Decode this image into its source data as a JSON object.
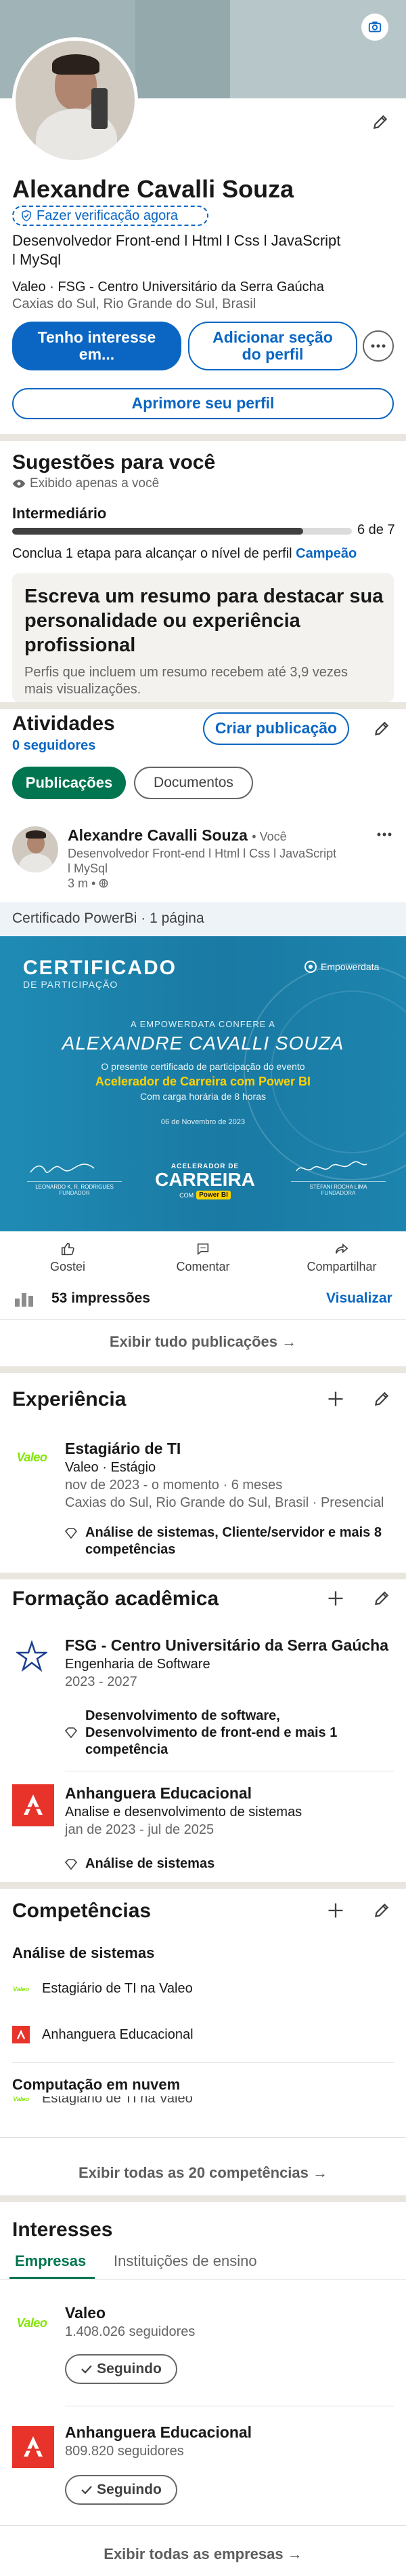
{
  "profile": {
    "name": "Alexandre Cavalli Souza",
    "verify_label": "Fazer verificação agora",
    "headline_line1": "Desenvolvedor Front-end l Html l Css l JavaScript",
    "headline_line2": "l MySql",
    "company_edu": "Valeo · FSG - Centro Universitário da Serra Gaúcha",
    "location": "Caxias do Sul, Rio Grande do Sul, Brasil",
    "interest_button": "Tenho interesse em...",
    "add_section_button": "Adicionar seção do perfil",
    "improve_button": "Aprimore seu perfil",
    "banner_color": "#a0b4b7",
    "avatar_bg": "#cfc9c0"
  },
  "suggestions": {
    "title": "Sugestões para você",
    "visibility": "Exibido apenas a você",
    "level": "Intermediário",
    "progress_label": "6 de 7",
    "progress_fraction": 0.857,
    "hint_prefix": "Conclua 1 etapa para alcançar o nível de perfil",
    "hint_link": "Campeão",
    "card_title_line1": "Escreva um resumo para destacar sua",
    "card_title_line2": "personalidade ou experiência",
    "card_title_line3": "profissional",
    "card_desc_line1": "Perfis que incluem um resumo recebem até 3,9 vezes",
    "card_desc_line2": "mais visualizações."
  },
  "activity": {
    "title": "Atividades",
    "followers": "0 seguidores",
    "create_post_button": "Criar publicação",
    "tabs": [
      "Publicações",
      "Documentos"
    ],
    "post": {
      "author": "Alexandre Cavalli Souza",
      "author_badge": "• Você",
      "headline_line1": "Desenvolvedor Front-end l Html l Css l JavaScript",
      "headline_line2": "l MySql",
      "time": "3 m •",
      "doc_title": "Certificado PowerBi · 1 página",
      "cert": {
        "title": "CERTIFICADO",
        "subtitle": "DE PARTICIPAÇÃO",
        "brand": "Empowerdata",
        "confers": "A EMPOWERDATA CONFERE A",
        "recipient": "ALEXANDRE CAVALLI SOUZA",
        "desc": "O presente certificado de participação do evento",
        "event": "Acelerador de Carreira com Power BI",
        "hours": "Com carga horária de 8 horas",
        "date": "06 de Novembro de 2023",
        "sig1_name": "LEONARDO K. R. RODRIGUES",
        "sig1_role": "FUNDADOR",
        "sig2_name": "STÉFANI ROCHA LIMA",
        "sig2_role": "FUNDADORA",
        "logo_top": "ACELERADOR DE",
        "logo_main": "CARREIRA",
        "logo_bottom": "COM",
        "logo_tag": "Power BI"
      },
      "actions": [
        "Gostei",
        "Comentar",
        "Compartilhar"
      ],
      "impressions": "53 impressões",
      "view_link": "Visualizar"
    },
    "show_all": "Exibir tudo publicações →"
  },
  "experience": {
    "title": "Experiência",
    "items": [
      {
        "logo": "Valeo",
        "role": "Estagiário de TI",
        "company": "Valeo · Estágio",
        "dates": "nov de 2023 - o momento · 6 meses",
        "location": "Caxias do Sul, Rio Grande do Sul, Brasil · Presencial",
        "skills_line1": "Análise de sistemas, Cliente/servidor e mais 8",
        "skills_line2": "competências"
      }
    ]
  },
  "education": {
    "title": "Formação acadêmica",
    "items": [
      {
        "school": "FSG - Centro Universitário da Serra Gaúcha",
        "degree": "Engenharia de Software",
        "dates": "2023 - 2027",
        "activities_line1": "Desenvolvimento de software,",
        "activities_line2": "Desenvolvimento de front-end e mais 1",
        "activities_line3": "competência"
      },
      {
        "school": "Anhanguera Educacional",
        "degree": "Analise e desenvolvimento de sistemas",
        "dates": "jan de 2023 - jul de 2025",
        "skills": "Análise de sistemas"
      }
    ]
  },
  "skills": {
    "title": "Competências",
    "skill1": "Análise de sistemas",
    "skill1_items": [
      "Estagiário de TI na Valeo",
      "Anhanguera Educacional"
    ],
    "skill2": "Computação em nuvem",
    "skill2_items": [
      "Estagiário de TI na Valeo"
    ],
    "show_all": "Exibir todas as 20 competências →"
  },
  "interests": {
    "title": "Interesses",
    "tabs": [
      "Empresas",
      "Instituições de ensino"
    ],
    "items": [
      {
        "name": "Valeo",
        "followers": "1.408.026 seguidores",
        "button": "Seguindo"
      },
      {
        "name": "Anhanguera Educacional",
        "followers": "809.820 seguidores",
        "button": "Seguindo"
      }
    ],
    "show_all": "Exibir todas as empresas →"
  },
  "colors": {
    "primary": "#0a66c2",
    "valeo_green": "#82e600",
    "anhanguera_red": "#e8332a",
    "cert_bg": "#1b7fa8",
    "cert_yellow": "#ffd200",
    "success_green": "#057642"
  }
}
